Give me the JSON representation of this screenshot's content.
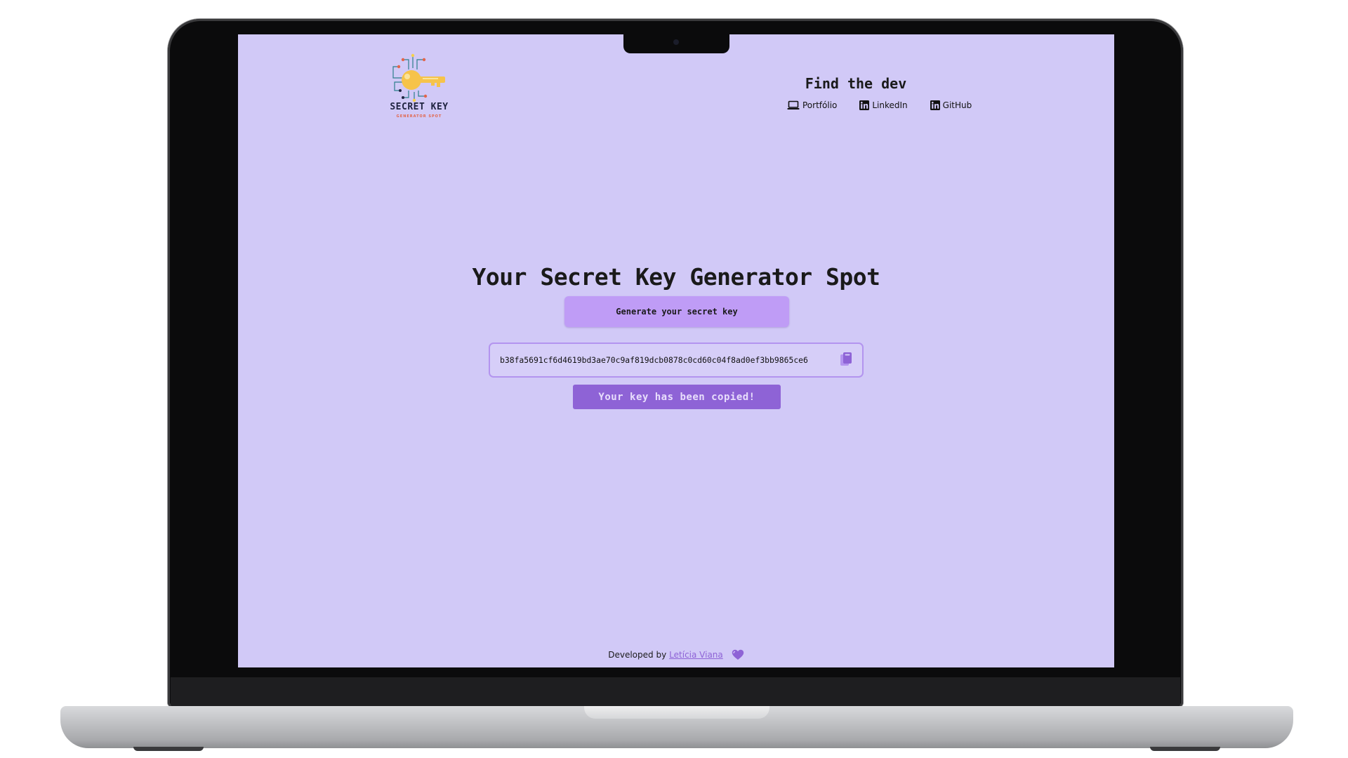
{
  "site": {
    "logo_title": "SECRET KEY",
    "logo_subtitle": "GENERATOR SPOT"
  },
  "header": {
    "find_dev_title": "Find the dev",
    "links": [
      {
        "label": "Portfólio",
        "icon": "laptop-icon"
      },
      {
        "label": "LinkedIn",
        "icon": "linkedin-icon"
      },
      {
        "label": "GitHub",
        "icon": "linkedin-icon"
      }
    ]
  },
  "main": {
    "title": "Your Secret Key Generator Spot",
    "generate_button_label": "Generate your secret key",
    "key_value": "b38fa5691cf6d4619bd3ae70c9af819dcb0878c0cd60c04f8ad0ef3bb9865ce6",
    "copy_icon": "copy-icon",
    "toast_message": "Your key has been copied!"
  },
  "footer": {
    "prefix": "Developed by",
    "author": "Letícia Viana",
    "icon": "heart-icon"
  },
  "colors": {
    "background": "#d1c9f7",
    "button": "#bf9cf6",
    "toast": "#8e63d6",
    "input_border": "#b394ef",
    "accent_link": "#8e63d6"
  }
}
